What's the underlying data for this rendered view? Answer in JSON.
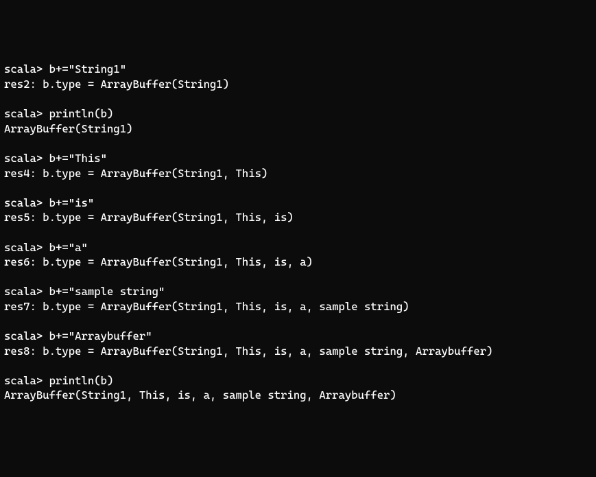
{
  "blocks": [
    {
      "prompt": "scala> b+=\"String1\"",
      "output": "res2: b.type = ArrayBuffer(String1)"
    },
    {
      "prompt": "scala> println(b)",
      "output": "ArrayBuffer(String1)"
    },
    {
      "prompt": "scala> b+=\"This\"",
      "output": "res4: b.type = ArrayBuffer(String1, This)"
    },
    {
      "prompt": "scala> b+=\"is\"",
      "output": "res5: b.type = ArrayBuffer(String1, This, is)"
    },
    {
      "prompt": "scala> b+=\"a\"",
      "output": "res6: b.type = ArrayBuffer(String1, This, is, a)"
    },
    {
      "prompt": "scala> b+=\"sample string\"",
      "output": "res7: b.type = ArrayBuffer(String1, This, is, a, sample string)"
    },
    {
      "prompt": "scala> b+=\"Arraybuffer\"",
      "output": "res8: b.type = ArrayBuffer(String1, This, is, a, sample string, Arraybuffer)"
    },
    {
      "prompt": "scala> println(b)",
      "output": "ArrayBuffer(String1, This, is, a, sample string, Arraybuffer)"
    }
  ]
}
